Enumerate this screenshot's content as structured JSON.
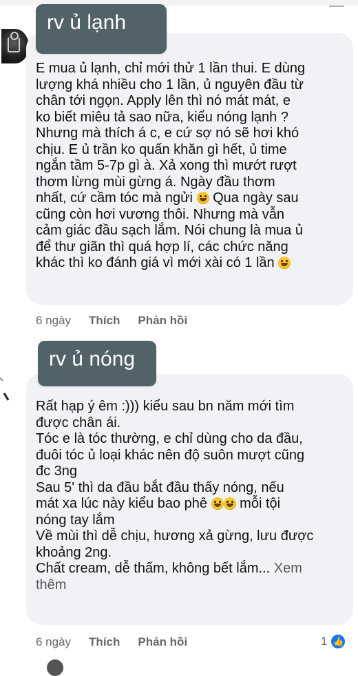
{
  "comments": [
    {
      "label": "rv ủ lạnh",
      "text": "E mua ủ lạnh, chỉ mới thử 1 lần thui. E dùng\nlượng khá nhiều cho 1 lần, ủ nguyên đầu từ\nchân tới ngọn. Apply lên thì nó mát mát, e\nko biết miêu tả sao nữa, kiểu nóng lạnh ?\nNhưng mà thích á c, e cứ sợ nó sẽ hơi khó\nchịu. E ủ trần ko quấn khăn gì hết, ủ time\nngắn tầm 5-7p gì à. Xả xong thì mướt rượt\nthơm lừng mùi gừng á. Ngày đầu thơm\nnhất, cứ cầm tóc mà ngửi",
      "text_b": " Qua ngày sau\ncũng còn hơi vương thôi. Nhưng mà vẫn\ncảm giác đầu sạch lắm. Nói chung là mua ủ\nđể thư giãn thì quá hợp lí, các chức năng\nkhác thì ko đánh giá vì mới xài có 1 lần ",
      "time": "6 ngày",
      "like": "Thích",
      "reply": "Phản hồi"
    },
    {
      "label": "rv ủ nóng",
      "text": "Rất hạp ý êm :))) kiểu sau bn năm mới tìm\nđược chân ái.\nTóc e là tóc thường, e chỉ dùng cho da đầu,\nđuôi tóc ủ loại khác nên độ suôn mượt cũng\nđc 3ng\nSau 5' thì da đầu bắt đầu thấy nóng, nếu\nmát xa lúc này kiểu bao phê",
      "text_b": " mỗi tội\nnóng tay lắm\nVề mùi thì dễ chịu, hương xả gừng, lưu được\nkhoảng 2ng.\nChất cream, dễ thấm, không bết lắm... ",
      "see_more": "Xem",
      "see_more_b": "thêm",
      "time": "6 ngày",
      "like": "Thích",
      "reply": "Phản hồi",
      "reaction_count": "1"
    }
  ],
  "colors": {
    "bubble": "#f0f2f5",
    "label_box": "#526269",
    "like_blue": "#1877f2",
    "meta_text": "#65676b"
  }
}
